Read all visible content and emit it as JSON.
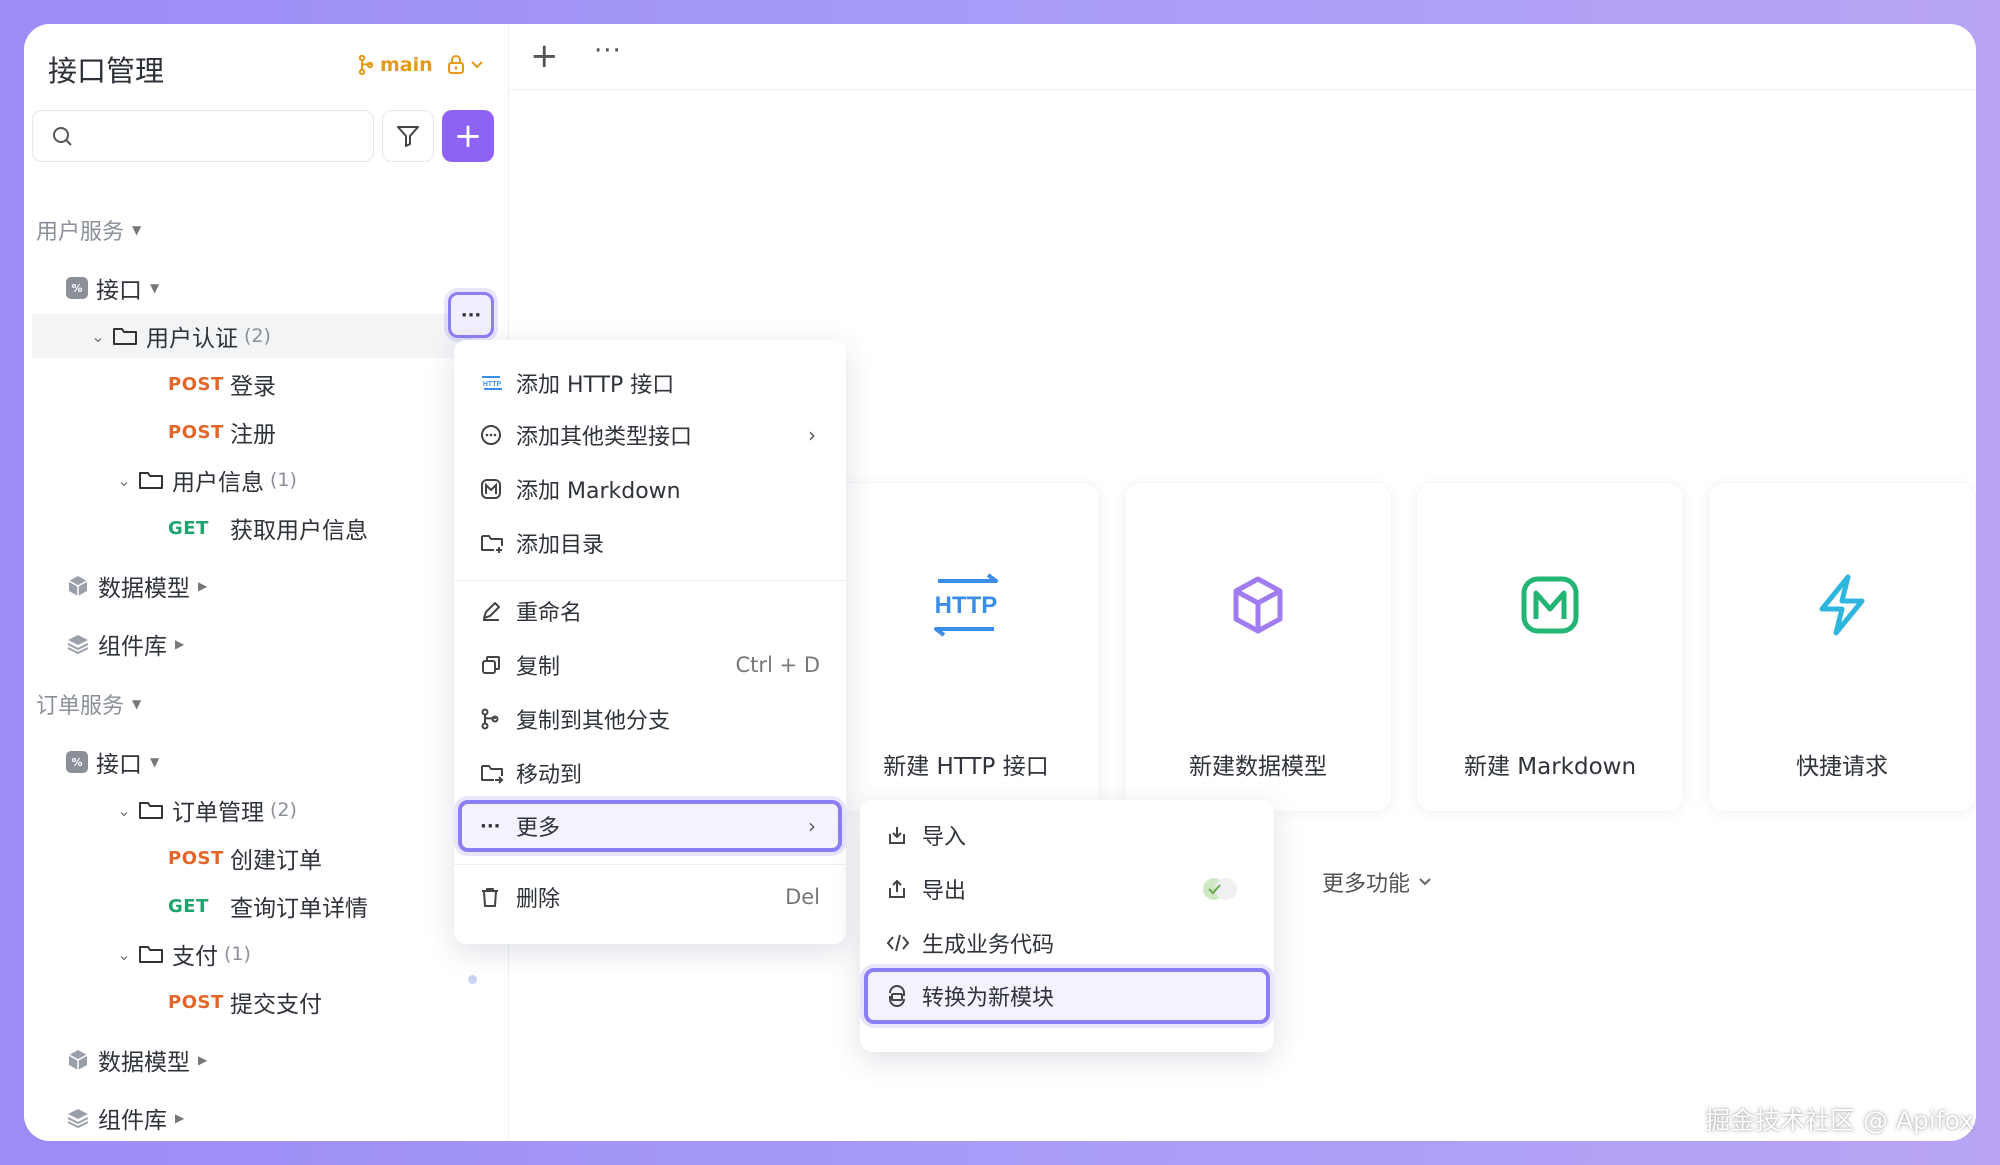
{
  "sidebar": {
    "title": "接口管理",
    "branch": "main",
    "groups": [
      {
        "name": "用户服务",
        "api_label": "接口",
        "folders": [
          {
            "name": "用户认证",
            "count": "(2)",
            "items": [
              {
                "method": "POST",
                "name": "登录"
              },
              {
                "method": "POST",
                "name": "注册"
              }
            ]
          },
          {
            "name": "用户信息",
            "count": "(1)",
            "items": [
              {
                "method": "GET",
                "name": "获取用户信息"
              }
            ]
          }
        ],
        "data_model_label": "数据模型",
        "components_label": "组件库"
      },
      {
        "name": "订单服务",
        "api_label": "接口",
        "folders": [
          {
            "name": "订单管理",
            "count": "(2)",
            "items": [
              {
                "method": "POST",
                "name": "创建订单"
              },
              {
                "method": "GET",
                "name": "查询订单详情"
              }
            ]
          },
          {
            "name": "支付",
            "count": "(1)",
            "items": [
              {
                "method": "POST",
                "name": "提交支付"
              }
            ]
          }
        ],
        "data_model_label": "数据模型",
        "components_label": "组件库"
      }
    ]
  },
  "main": {
    "cards": [
      {
        "label": "新建 HTTP 接口",
        "icon": "http-icon"
      },
      {
        "label": "新建数据模型",
        "icon": "cube-icon"
      },
      {
        "label": "新建 Markdown",
        "icon": "markdown-icon"
      },
      {
        "label": "快捷请求",
        "icon": "lightning-icon"
      }
    ],
    "more_features": "更多功能",
    "http_badge": "HTTP"
  },
  "context_menu": {
    "items": [
      {
        "label": "添加 HTTP 接口"
      },
      {
        "label": "添加其他类型接口"
      },
      {
        "label": "添加 Markdown"
      },
      {
        "label": "添加目录"
      },
      {
        "label": "重命名"
      },
      {
        "label": "复制",
        "shortcut": "Ctrl + D"
      },
      {
        "label": "复制到其他分支"
      },
      {
        "label": "移动到"
      },
      {
        "label": "更多"
      },
      {
        "label": "删除",
        "shortcut": "Del"
      }
    ]
  },
  "submenu": {
    "items": [
      {
        "label": "导入"
      },
      {
        "label": "导出"
      },
      {
        "label": "生成业务代码"
      },
      {
        "label": "转换为新模块"
      }
    ]
  },
  "watermark": "掘金技术社区 @ Apifox",
  "colors": {
    "accent": "#8e62f5",
    "post": "#e2662a",
    "get": "#1ea36b",
    "http_blue": "#3b8ee8",
    "cube_purple": "#a07cf0",
    "markdown_green": "#22b573",
    "lightning_cyan": "#2fb6de"
  }
}
